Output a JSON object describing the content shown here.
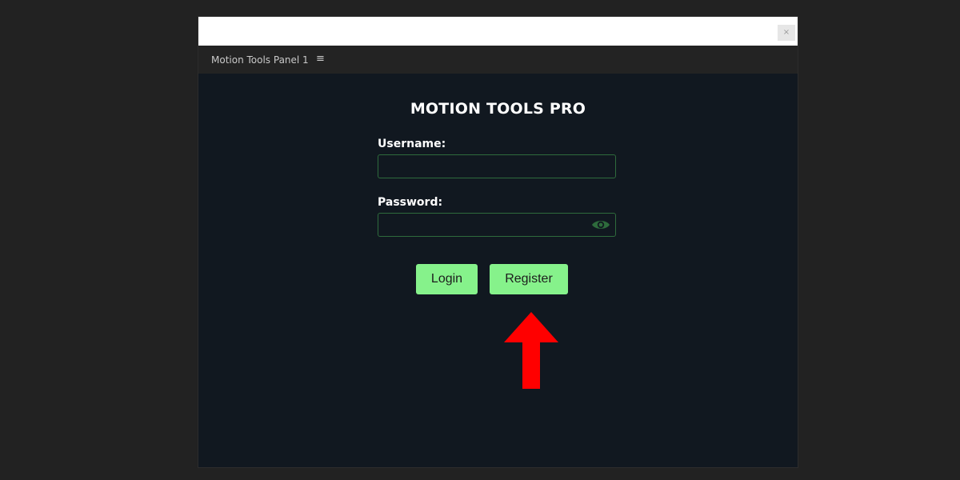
{
  "window": {
    "close_symbol": "×"
  },
  "panel": {
    "tab_label": "Motion Tools Panel 1",
    "menu_icon": "≡"
  },
  "app": {
    "title": "MOTION TOOLS PRO"
  },
  "form": {
    "username_label": "Username:",
    "username_value": "",
    "password_label": "Password:",
    "password_value": "",
    "eye_icon": "eye-icon",
    "login_label": "Login",
    "register_label": "Register"
  },
  "annotation": {
    "arrow_icon": "red-up-arrow-icon"
  },
  "colors": {
    "background": "#222222",
    "panel_bg": "#111820",
    "accent_button": "#86f28b",
    "input_border": "#2e6b3c",
    "arrow": "#ff0000"
  }
}
